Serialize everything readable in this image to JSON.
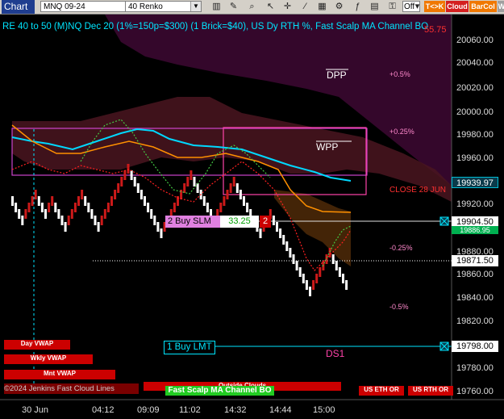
{
  "toolbar": {
    "title": "Chart",
    "instrument": "MNQ 09-24",
    "bar_type": "40 Renko",
    "off_label": "Off",
    "btn_tk": "T<>K",
    "btn_cloud": "Cloud",
    "btn_barcol": "BarCol",
    "btn_w": "W"
  },
  "chart": {
    "header": "RE 40 to 50 (M)NQ Dec 20 (1%=150p=$300) (1 Brick=$40), US Dy RTH %, Fast Scalp MA Channel BO",
    "top_price_label": "55.75",
    "y_ticks": [
      "20060.00",
      "20040.00",
      "20020.00",
      "20000.00",
      "19980.00",
      "19960.00",
      "19920.00",
      "19880.00",
      "19860.00",
      "19840.00",
      "19820.00",
      "19780.00",
      "19760.00"
    ],
    "x_ticks": [
      "30 Jun",
      "04:12",
      "09:09",
      "11:02",
      "14:32",
      "14:44",
      "15:00"
    ],
    "pct_labels": [
      "+0.5%",
      "+0.25%",
      "-0.25%",
      "-0.5%"
    ],
    "levels": {
      "dpp": "DPP",
      "wpp": "WPP",
      "close": "CLOSE 28 JUN",
      "ds1": "DS1"
    },
    "price_boxes": {
      "p1": "19939.97",
      "p2": "19904.50",
      "p3": "19886.95",
      "p4": "19871.50",
      "p5": "19798.00"
    },
    "orders": {
      "buy_slm_label": "2 Buy SLM",
      "buy_slm_price": "33.25",
      "buy_slm_qty": "2",
      "buy_lmt_label": "1 Buy LMT"
    },
    "bottom_bars": {
      "day_vwap": "Day VWAP",
      "wkly_vwap": "Wkly VWAP",
      "mnt_vwap": "Mnt VWAP",
      "cloud_lines": "©2024 Jenkins Fast Cloud Lines",
      "outside_clouds": "Outside Clouds",
      "fast_scalp": "Fast Scalp MA Channel BO",
      "us_eth": "US ETH OR",
      "us_rth": "US RTH OR"
    },
    "colors": {
      "bull": "#ffffff",
      "bear": "#cc1a1a",
      "cyan": "#00e5ff",
      "accent": "#ff3030"
    }
  }
}
